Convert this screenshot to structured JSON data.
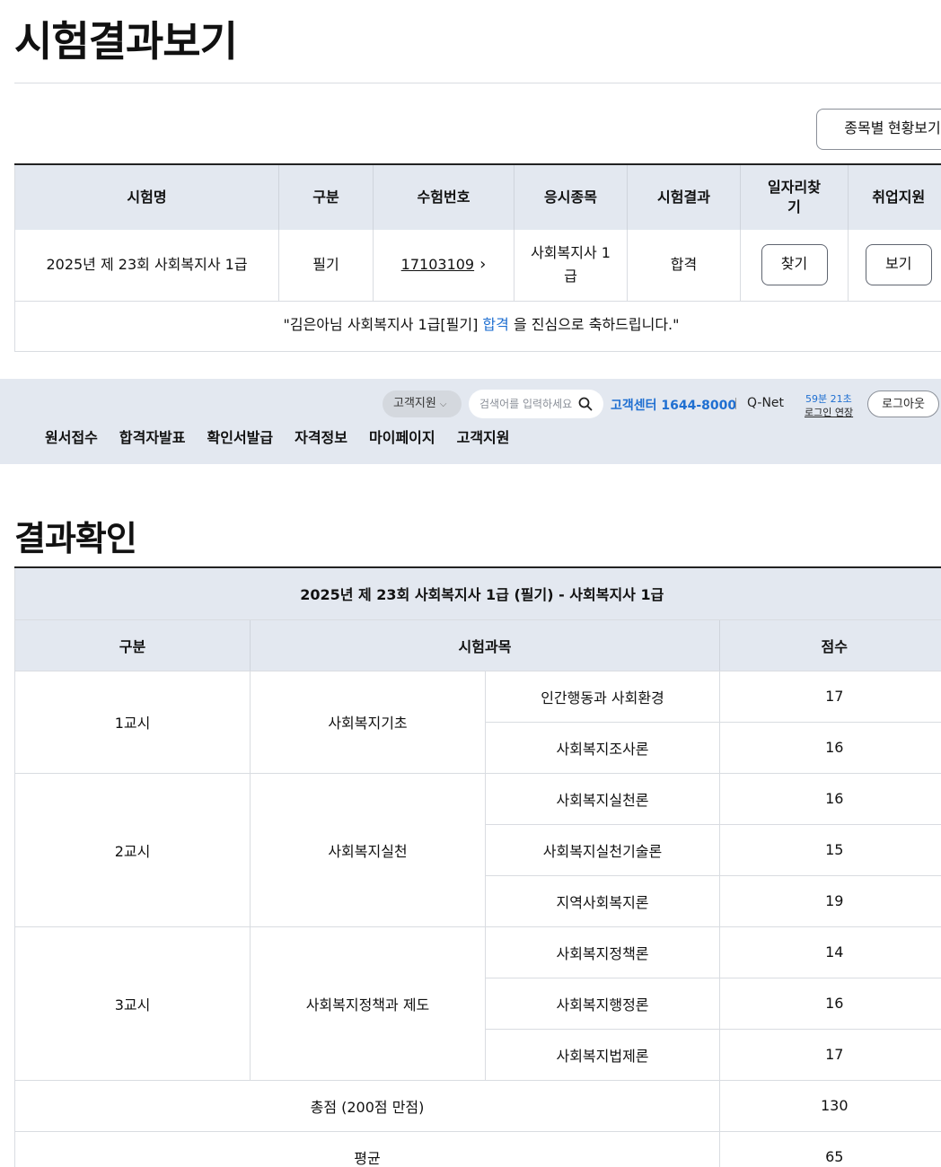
{
  "page": {
    "title": "시험결과보기",
    "status_button": "종목별 현황보기"
  },
  "result_table": {
    "headers": [
      "시험명",
      "구분",
      "수험번호",
      "응시종목",
      "시험결과",
      "일자리찾기",
      "취업지원"
    ],
    "row": {
      "exam_name": "2025년 제 23회 사회복지사 1급",
      "category": "필기",
      "exam_number": "17103109",
      "subject": "사회복지사 1급",
      "result": "합격",
      "find_job_button": "찾기",
      "support_button": "보기"
    },
    "congrats": {
      "prefix": "\"김은아님 사회복지사 1급[필기] ",
      "pass_word": "합격",
      "suffix": " 을 진심으로 축하드립니다.\""
    }
  },
  "header": {
    "dropdown_label": "고객지원",
    "search_placeholder": "검색어를 입력하세요",
    "phone": "고객센터 1644-8000",
    "qnet": "Q-Net",
    "timer": "59분 21초",
    "extend_label": "로그인 연장",
    "logout": "로그아웃",
    "nav": [
      "원서접수",
      "합격자발표",
      "확인서발급",
      "자격정보",
      "마이페이지",
      "고객지원"
    ]
  },
  "score": {
    "section_title": "결과확인",
    "exam_title": "2025년 제 23회 사회복지사 1급 (필기) - 사회복지사 1급",
    "headers": {
      "category": "구분",
      "subject": "시험과목",
      "score": "점수"
    },
    "periods": [
      {
        "period": "1교시",
        "area": "사회복지기초",
        "subjects": [
          {
            "name": "인간행동과 사회환경",
            "score": "17"
          },
          {
            "name": "사회복지조사론",
            "score": "16"
          }
        ]
      },
      {
        "period": "2교시",
        "area": "사회복지실천",
        "subjects": [
          {
            "name": "사회복지실천론",
            "score": "16"
          },
          {
            "name": "사회복지실천기술론",
            "score": "15"
          },
          {
            "name": "지역사회복지론",
            "score": "19"
          }
        ]
      },
      {
        "period": "3교시",
        "area": "사회복지정책과 제도",
        "subjects": [
          {
            "name": "사회복지정책론",
            "score": "14"
          },
          {
            "name": "사회복지행정론",
            "score": "16"
          },
          {
            "name": "사회복지법제론",
            "score": "17"
          }
        ]
      }
    ],
    "total_label": "총점 (200점 만점)",
    "total": "130",
    "average_label": "평균",
    "average": "65"
  }
}
